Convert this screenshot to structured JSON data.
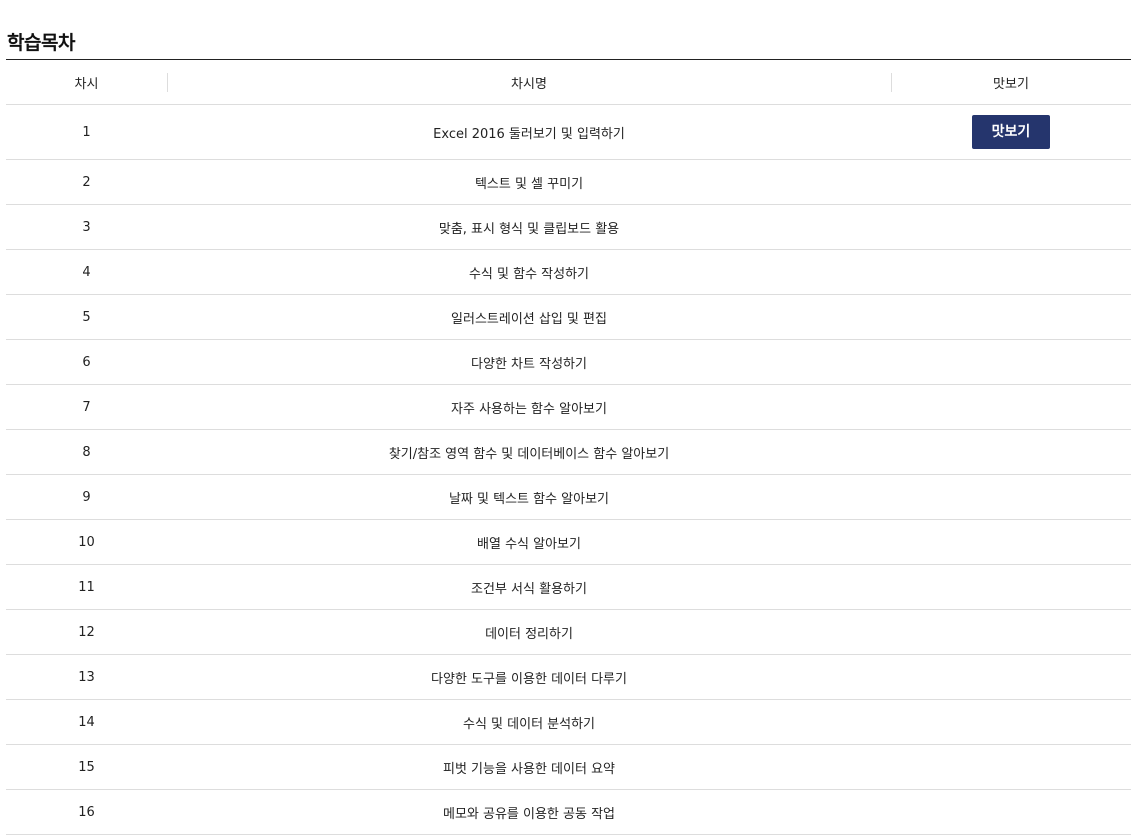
{
  "page": {
    "title": "학습목차"
  },
  "table": {
    "headers": {
      "session": "차시",
      "session_name": "차시명",
      "preview": "맛보기"
    },
    "preview_button_label": "맛보기",
    "rows": [
      {
        "no": "1",
        "name": "Excel 2016 둘러보기 및 입력하기",
        "has_preview": true
      },
      {
        "no": "2",
        "name": "텍스트 및 셀 꾸미기",
        "has_preview": false
      },
      {
        "no": "3",
        "name": "맞춤, 표시 형식 및 클립보드 활용",
        "has_preview": false
      },
      {
        "no": "4",
        "name": "수식 및 함수 작성하기",
        "has_preview": false
      },
      {
        "no": "5",
        "name": "일러스트레이션 삽입 및 편집",
        "has_preview": false
      },
      {
        "no": "6",
        "name": "다양한 차트 작성하기",
        "has_preview": false
      },
      {
        "no": "7",
        "name": "자주 사용하는 함수 알아보기",
        "has_preview": false
      },
      {
        "no": "8",
        "name": "찾기/참조 영역 함수 및 데이터베이스 함수 알아보기",
        "has_preview": false
      },
      {
        "no": "9",
        "name": "날짜 및 텍스트 함수 알아보기",
        "has_preview": false
      },
      {
        "no": "10",
        "name": "배열 수식 알아보기",
        "has_preview": false
      },
      {
        "no": "11",
        "name": "조건부 서식 활용하기",
        "has_preview": false
      },
      {
        "no": "12",
        "name": "데이터 정리하기",
        "has_preview": false
      },
      {
        "no": "13",
        "name": "다양한 도구를 이용한 데이터 다루기",
        "has_preview": false
      },
      {
        "no": "14",
        "name": "수식 및 데이터 분석하기",
        "has_preview": false
      },
      {
        "no": "15",
        "name": "피벗 기능을 사용한 데이터 요약",
        "has_preview": false
      },
      {
        "no": "16",
        "name": "메모와 공유를 이용한 공동 작업",
        "has_preview": false
      }
    ]
  },
  "colors": {
    "preview_button_bg": "#25356d",
    "preview_button_text": "#ffffff",
    "header_rule": "#222222",
    "row_rule": "#dddddd"
  }
}
